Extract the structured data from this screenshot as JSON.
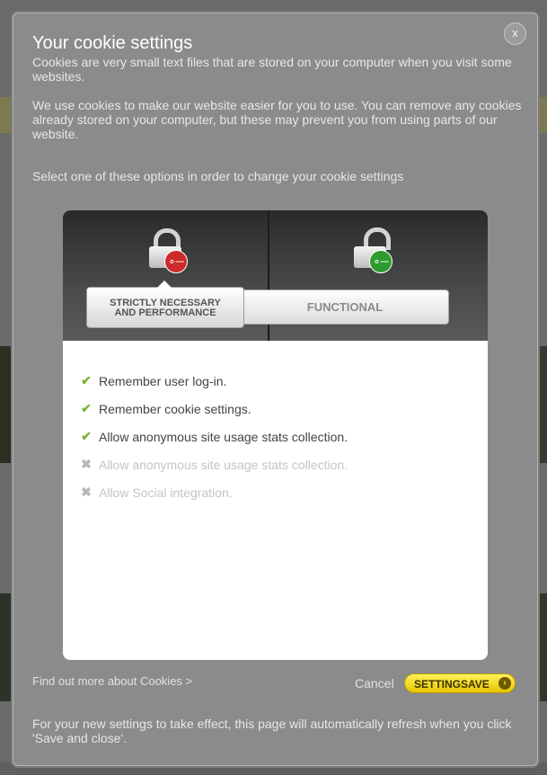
{
  "modal": {
    "close_label": "x",
    "title": "Your cookie settings",
    "intro": "Cookies are very small text files that are stored on your computer when you visit some websites.",
    "usage": "We use cookies to make our website easier for you to use. You can remove any cookies already stored on your computer, but these may prevent you from using parts of our website.",
    "instruction": "Select one of these options in order to change your cookie settings"
  },
  "options": {
    "strict_label_line1": "STRICTLY NECESSARY",
    "strict_label_line2": "AND PERFORMANCE",
    "functional_label": "FUNCTIONAL",
    "selected": "STRICTLY NECESSARY AND PERFORMANCE"
  },
  "features": [
    {
      "label": "Remember user log-in.",
      "enabled": true
    },
    {
      "label": "Remember cookie settings.",
      "enabled": true
    },
    {
      "label": "Allow anonymous site usage stats collection.",
      "enabled": true
    },
    {
      "label": "Allow anonymous site usage stats collection.",
      "enabled": false
    },
    {
      "label": "Allow Social integration.",
      "enabled": false
    }
  ],
  "icons": {
    "enabled": "checkmark-icon",
    "disabled": "cross-icon",
    "strict_lock": "locked-padlock-red-key-icon",
    "functional_lock": "unlocked-padlock-green-key-icon"
  },
  "colors": {
    "save_button": "#f5e11e",
    "enabled_check": "#7db536",
    "strict_key": "#cc2b2b",
    "functional_key": "#2e9b2e"
  },
  "footer": {
    "find_more": "Find out more about Cookies >",
    "cancel": "Cancel",
    "save": "SETTINGSAVE",
    "note": "For your new settings to take effect, this page will automatically refresh when you click 'Save and close'."
  }
}
